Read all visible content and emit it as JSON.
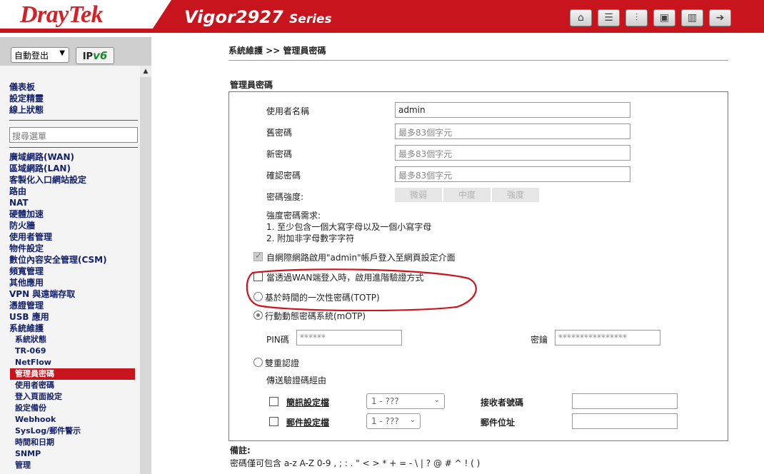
{
  "brand": "DrayTek",
  "model": {
    "name": "Vigor2927",
    "series": "Series"
  },
  "toolbar": [
    {
      "icon": "home-icon",
      "glyph": "⌂"
    },
    {
      "icon": "menu-icon",
      "glyph": "☰"
    },
    {
      "icon": "sliders-icon",
      "glyph": "⫶"
    },
    {
      "icon": "save-icon",
      "glyph": "▣"
    },
    {
      "icon": "book-icon",
      "glyph": "▥"
    },
    {
      "icon": "logout-icon",
      "glyph": "➔"
    }
  ],
  "sidebar": {
    "logout_select": "自動登出",
    "ipv6_badge": {
      "ip": "IP",
      "v6": "v6"
    },
    "top_links": [
      "儀表板",
      "設定精靈",
      "線上狀態"
    ],
    "search_placeholder": "搜尋選單",
    "menu": [
      "廣域網路(WAN)",
      "區域網路(LAN)",
      "客製化入口網站設定",
      "路由",
      "NAT",
      "硬體加速",
      "防火牆",
      "使用者管理",
      "物件設定",
      "數位內容安全管理(CSM)",
      "頻寬管理",
      "其他應用",
      "VPN 與遠端存取",
      "憑證管理",
      "USB 應用",
      "系統維護"
    ],
    "submenu": [
      "系統狀態",
      "TR-069",
      "NetFlow",
      "管理員密碼",
      "使用者密碼",
      "登入頁面設定",
      "設定備份",
      "Webhook",
      "SysLog/郵件警示",
      "時間和日期",
      "SNMP"
    ],
    "active_submenu": "管理員密碼",
    "bottom_item": "管理"
  },
  "breadcrumb": "系統維護 >> 管理員密碼",
  "section_title": "管理員密碼",
  "form": {
    "username_label": "使用者名稱",
    "username_value": "admin",
    "old_password_label": "舊密碼",
    "old_password_placeholder": "最多83個字元",
    "new_password_label": "新密碼",
    "new_password_placeholder": "最多83個字元",
    "confirm_password_label": "確認密碼",
    "confirm_password_placeholder": "最多83個字元",
    "strength_label": "密碼強度:",
    "strength_levels": [
      "微弱",
      "中度",
      "強度"
    ],
    "requirements_title": "強度密碼需求:",
    "requirement_1": "1. 至少包含一個大寫字母以及一個小寫字母",
    "requirement_2": "2. 附加非字母數字字符",
    "wan_admin_login_label": "自網際網路啟用\"admin\"帳戶登入至網頁設定介面",
    "advanced_auth_label": "當透過WAN端登入時，啟用進階驗證方式",
    "totp_label": "基於時間的一次性密碼(TOTP)",
    "motp_label": "行動動態密碼系統(mOTP)",
    "pin_label": "PIN碼",
    "pin_value": "******",
    "key_label": "密鑰",
    "key_value": "****************",
    "dual_auth_label": "雙重認證",
    "send_via_label": "傳送驗證碼經由",
    "sms_profile_label": "簡訊設定檔",
    "sms_profile_select": "1 - ???",
    "recipient_label": "接收者號碼",
    "mail_profile_label": "郵件設定檔",
    "mail_profile_select": "1 - ???",
    "mail_address_label": "郵件位址"
  },
  "notes": {
    "title": "備註:",
    "text": "密碼僅可包含 a-z A-Z 0-9 , ; : . \" < > * + = - \\ | ? @ # ^ ! ( )"
  },
  "colors": {
    "brand_red": "#c8151d",
    "menu_text": "#13206a",
    "annotation_red": "#d0121b"
  }
}
